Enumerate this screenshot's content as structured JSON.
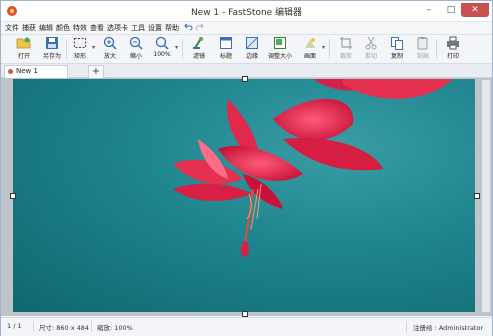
{
  "window": {
    "title": "New 1 - FastStone 编辑器",
    "controls": {
      "minimize": "–",
      "maximize": "□",
      "close": "✕"
    }
  },
  "menu": {
    "items": [
      "文件",
      "捕获",
      "编辑",
      "颜色",
      "特效",
      "查看",
      "选项卡",
      "工具",
      "设置",
      "帮助"
    ],
    "undo_icon": "undo-icon",
    "redo_icon": "redo-icon"
  },
  "toolbar": {
    "open": "打开",
    "save_as": "另存为",
    "rect": "矩形",
    "zoom_in": "放大",
    "zoom_out": "缩小",
    "zoom_100": "100%",
    "filter": "滤镜",
    "caption": "标题",
    "edge": "边缘",
    "resize": "调整大小",
    "canvas": "画面",
    "crop": "裁剪",
    "cut": "剪切",
    "copy": "复制",
    "paste": "粘贴",
    "print": "打印"
  },
  "tabs": {
    "doc_tab_label": "New 1",
    "add_label": "+"
  },
  "status": {
    "page": "1 / 1",
    "size": "尺寸: 860 x 484",
    "zoom": "缩放: 100%",
    "registered": "注册给 : Administrator"
  },
  "colors": {
    "canvas_background": "#20868f",
    "flower": "#e0284a",
    "close_button": "#c75050"
  }
}
